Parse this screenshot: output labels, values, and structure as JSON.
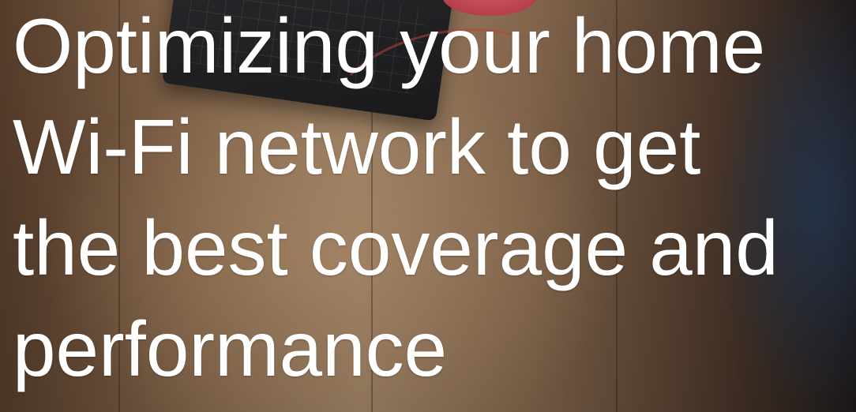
{
  "hero": {
    "headline_lines": [
      "Optimizing your home",
      "Wi-Fi network to get",
      "the best coverage and",
      "performance"
    ]
  }
}
